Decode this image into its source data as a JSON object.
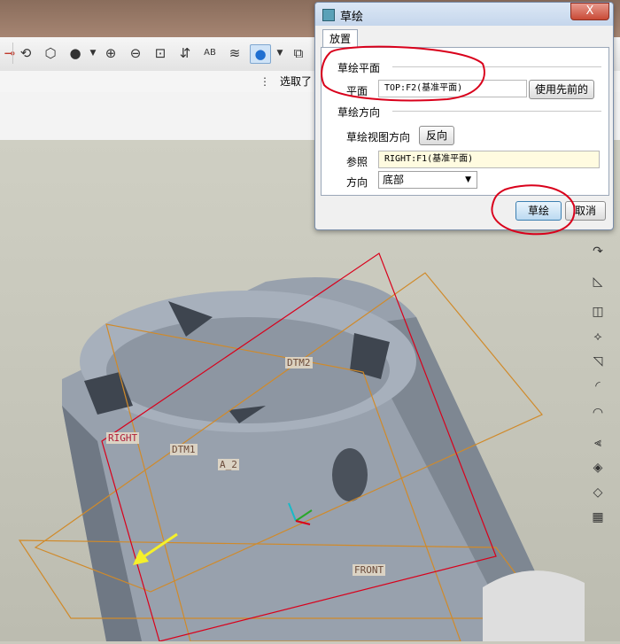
{
  "toolbar": {
    "icons": [
      "sketch-tool-icon",
      "repaint-icon",
      "orient-icon",
      "sphere-icon",
      "zoom-in-icon",
      "zoom-out-icon",
      "refit-icon",
      "view-manager-icon",
      "annotation-display-icon",
      "layers-icon",
      "shading-icon",
      "filter-icon"
    ],
    "select_label": "选取了"
  },
  "dialog": {
    "title": "草绘",
    "close_glyph": "X",
    "tab_label": "放置",
    "sketch_plane": {
      "group_label": "草绘平面",
      "plane_label": "平面",
      "plane_value": "TOP:F2(基准平面)",
      "use_previous_button": "使用先前的"
    },
    "sketch_orientation": {
      "group_label": "草绘方向",
      "view_direction_label": "草绘视图方向",
      "flip_button": "反向",
      "reference_label": "参照",
      "reference_value": "RIGHT:F1(基准平面)",
      "direction_label": "方向",
      "direction_value": "底部"
    },
    "sketch_button": "草绘",
    "cancel_button": "取消"
  },
  "viewport": {
    "plane_labels": [
      "RIGHT",
      "DTM1",
      "DTM2",
      "A_2",
      "FRONT"
    ]
  },
  "colors": {
    "annotation_red": "#d9001b",
    "datum_plane_orange": "#d08a2a",
    "model_gray": "#8f98a4",
    "arrow_yellow": "#f5f02a"
  }
}
